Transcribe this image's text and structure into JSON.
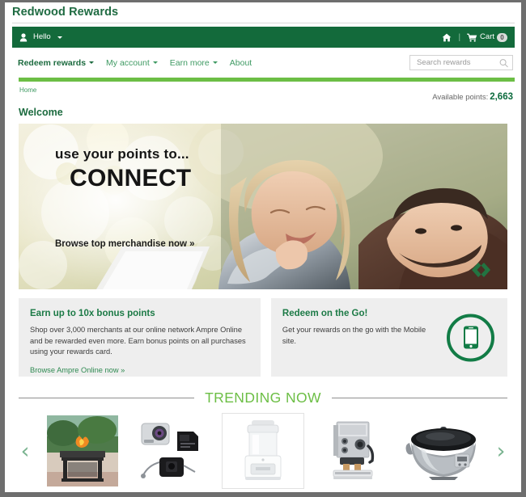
{
  "brand": {
    "title": "Redwood Rewards"
  },
  "userbar": {
    "greeting": "Hello",
    "user_icon": "user-icon",
    "home_icon": "home-icon",
    "divider": "|",
    "cart_label": "Cart",
    "cart_count": "0"
  },
  "nav": {
    "items": [
      {
        "label": "Redeem rewards",
        "has_caret": true,
        "active": true
      },
      {
        "label": "My account",
        "has_caret": true,
        "active": false
      },
      {
        "label": "Earn more",
        "has_caret": true,
        "active": false
      },
      {
        "label": "About",
        "has_caret": false,
        "active": false
      }
    ],
    "search": {
      "placeholder": "Search rewards",
      "value": "",
      "icon": "search-icon"
    }
  },
  "breadcrumb": {
    "label": "Home"
  },
  "points": {
    "label": "Available points:",
    "value": "2,663"
  },
  "welcome": {
    "title": "Welcome"
  },
  "hero": {
    "line1": "use your points to...",
    "line2": "CONNECT",
    "cta": "Browse top merchandise now »",
    "logo_icon": "chevron-pair-logo-icon",
    "alt": "photo of a man and a young girl smiling together outdoors with bokeh light background"
  },
  "cards": [
    {
      "title": "Earn up to 10x bonus points",
      "body": "Shop over 3,000 merchants at our online network Ampre Online and be rewarded even more. Earn bonus points on all purchases using your rewards card.",
      "link": "Browse Ampre Online now »"
    },
    {
      "title": "Redeem on the Go!",
      "body": "Get your rewards on the go with the Mobile site.",
      "link": "",
      "icon": "mobile-phone-icon"
    }
  ],
  "trending": {
    "title": "TRENDING NOW",
    "prev_icon": "chevron-left-icon",
    "next_icon": "chevron-right-icon",
    "products": [
      {
        "name": "outdoor-fire-pit-table"
      },
      {
        "name": "action-camera-with-memory-card-and-case"
      },
      {
        "name": "white-ice-cream-maker"
      },
      {
        "name": "stainless-espresso-machine"
      },
      {
        "name": "slow-cooker-crock-pot"
      }
    ]
  },
  "colors": {
    "brand_green": "#1f6b42",
    "bar_green": "#136a3b",
    "accent_green": "#6cbe45",
    "link_green": "#3f9a63",
    "arrow_green": "#79b38f",
    "card_gray": "#eeeeee"
  }
}
